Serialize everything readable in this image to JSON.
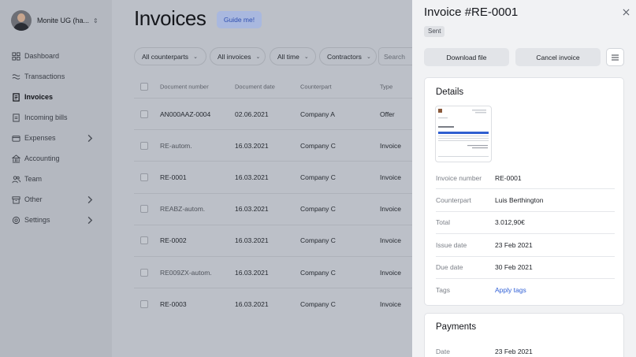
{
  "sidebar": {
    "profile_name": "Monite UG (ha...",
    "items": [
      {
        "label": "Dashboard",
        "icon": "dashboard-icon"
      },
      {
        "label": "Transactions",
        "icon": "transactions-icon"
      },
      {
        "label": "Invoices",
        "icon": "invoices-icon"
      },
      {
        "label": "Incoming bills",
        "icon": "incoming-bills-icon"
      },
      {
        "label": "Expenses",
        "icon": "expenses-icon"
      },
      {
        "label": "Accounting",
        "icon": "accounting-icon"
      },
      {
        "label": "Team",
        "icon": "team-icon"
      },
      {
        "label": "Other",
        "icon": "other-icon"
      },
      {
        "label": "Settings",
        "icon": "settings-icon"
      }
    ]
  },
  "main": {
    "title": "Invoices",
    "guide_label": "Guide me!",
    "filters": [
      "All counterparts",
      "All invoices",
      "All time",
      "Contractors"
    ],
    "search_placeholder": "Search",
    "columns": [
      "Document number",
      "Document date",
      "Counterpart",
      "Type"
    ],
    "rows": [
      {
        "number": "AN000AAZ-0004",
        "date": "02.06.2021",
        "counterpart": "Company A",
        "type": "Offer"
      },
      {
        "number": "RE-autom.",
        "date": "16.03.2021",
        "counterpart": "Company C",
        "type": "Invoice"
      },
      {
        "number": "RE-0001",
        "date": "16.03.2021",
        "counterpart": "Company C",
        "type": "Invoice"
      },
      {
        "number": "REABZ-autom.",
        "date": "16.03.2021",
        "counterpart": "Company C",
        "type": "Invoice"
      },
      {
        "number": "RE-0002",
        "date": "16.03.2021",
        "counterpart": "Company C",
        "type": "Invoice"
      },
      {
        "number": "RE009ZX-autom.",
        "date": "16.03.2021",
        "counterpart": "Company C",
        "type": "Invoice"
      },
      {
        "number": "RE-0003",
        "date": "16.03.2021",
        "counterpart": "Company C",
        "type": "Invoice"
      }
    ]
  },
  "drawer": {
    "title": "Invoice #RE-0001",
    "status": "Sent",
    "download_label": "Download file",
    "cancel_label": "Cancel invoice",
    "details_title": "Details",
    "details": [
      {
        "label": "Invoice number",
        "value": "RE-0001"
      },
      {
        "label": "Counterpart",
        "value": "Luis Berthington"
      },
      {
        "label": "Total",
        "value": "3.012,90€"
      },
      {
        "label": "Issue date",
        "value": "23 Feb 2021"
      },
      {
        "label": "Due date",
        "value": "30 Feb 2021"
      },
      {
        "label": "Tags",
        "value": "Apply tags"
      }
    ],
    "payments_title": "Payments",
    "payments": [
      {
        "label": "Date",
        "value": "23 Feb 2021"
      }
    ]
  },
  "colors": {
    "accent": "#3160d6",
    "guide_button_bg": "#a9b8df",
    "overlay": "#bcc0c8",
    "drawer_bg": "#f1f2f4"
  }
}
